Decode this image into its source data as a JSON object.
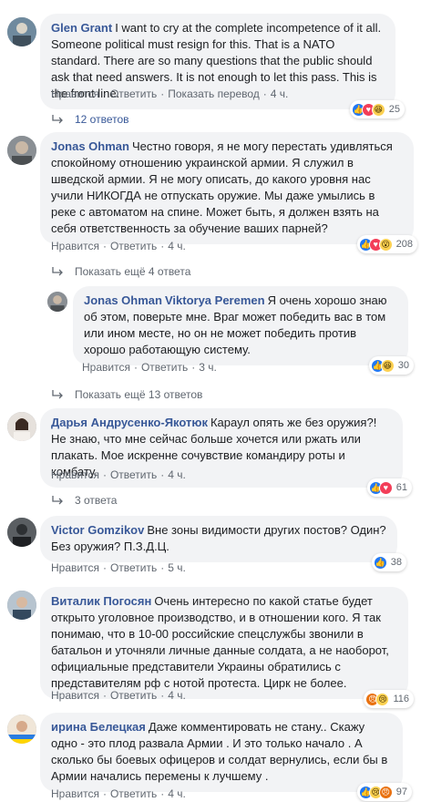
{
  "comments": [
    {
      "author": "Glen Grant",
      "text": "I want to cry at the complete incompetence of it all. Someone political must resign for this. That is a NATO standard. There are so many questions that the public should ask that need answers. It is not enough to let this pass. This is the front line.",
      "actions": [
        "Нравится",
        "Ответить",
        "Показать перевод"
      ],
      "time": "4 ч.",
      "reactions": [
        "like-icon",
        "love-icon",
        "laugh-icon"
      ],
      "reaction_count": "25",
      "replies": "12 ответов"
    },
    {
      "author": "Jonas Ohman",
      "text": "Честно говоря, я не могу перестать удивляться спокойному отношению украинской армии. Я служил в шведской армии. Я не могу описать, до какого уровня нас учили НИКОГДА не отпускать оружие. Мы даже умылись в реке с автоматом на спине. Может быть, я должен взять на себя ответственность за обучение ваших парней?",
      "actions": [
        "Нравится",
        "Ответить"
      ],
      "time": "4 ч.",
      "reactions": [
        "like-icon",
        "love-icon",
        "wow-icon"
      ],
      "reaction_count": "208",
      "replies": "Показать ещё 4 ответа"
    },
    {
      "author": "Jonas Ohman",
      "tagged": "Viktorya Peremen",
      "text": "Я очень хорошо знаю об этом, поверьте мне. Враг может победить вас в том или ином месте, но он не может победить против хорошо работающую систему.",
      "actions": [
        "Нравится",
        "Ответить"
      ],
      "time": "3 ч.",
      "reactions": [
        "like-icon",
        "laugh-icon"
      ],
      "reaction_count": "30",
      "replies": "Показать ещё 13 ответов"
    },
    {
      "author": "Дарья Андрусенко-Якотюк",
      "text": "Караул опять же без оружия?! Не знаю, что мне сейчас больше хочется или ржать или плакать. Мое искренне сочувствие командиру роты и комбату.",
      "actions": [
        "Нравится",
        "Ответить"
      ],
      "time": "4 ч.",
      "reactions": [
        "like-icon",
        "love-icon"
      ],
      "reaction_count": "61",
      "replies": "3 ответа"
    },
    {
      "author": "Victor Gomzikov",
      "text": "Вне зоны видимости других постов? Один? Без оружия? П.З.Д.Ц.",
      "actions": [
        "Нравится",
        "Ответить"
      ],
      "time": "5 ч.",
      "reactions": [
        "like-icon"
      ],
      "reaction_count": "38"
    },
    {
      "author": "Виталик Погосян",
      "text": "Очень интересно по какой статье будет открыто уголовное производство, и в отношении кого. Я так понимаю, что в 10-00 российские спецслужбы звонили в батальон и уточняли личные данные солдата, а не наоборот, официальные представители Украины обратились с представителям рф с нотой протеста. Цирк не более.",
      "actions": [
        "Нравится",
        "Ответить"
      ],
      "time": "4 ч.",
      "reactions": [
        "angry-icon",
        "sad-icon"
      ],
      "reaction_count": "116"
    },
    {
      "author": "ирина Белецкая",
      "text": "Даже комментировать не стану.. Скажу одно - это плод развала Армии . И это только начало . А сколько бы боевых офицеров и солдат вернулись, если бы в Армии начались перемены к лучшему .",
      "actions": [
        "Нравится",
        "Ответить"
      ],
      "time": "4 ч.",
      "reactions": [
        "like-icon",
        "sad-icon",
        "angry-icon"
      ],
      "reaction_count": "97"
    }
  ]
}
